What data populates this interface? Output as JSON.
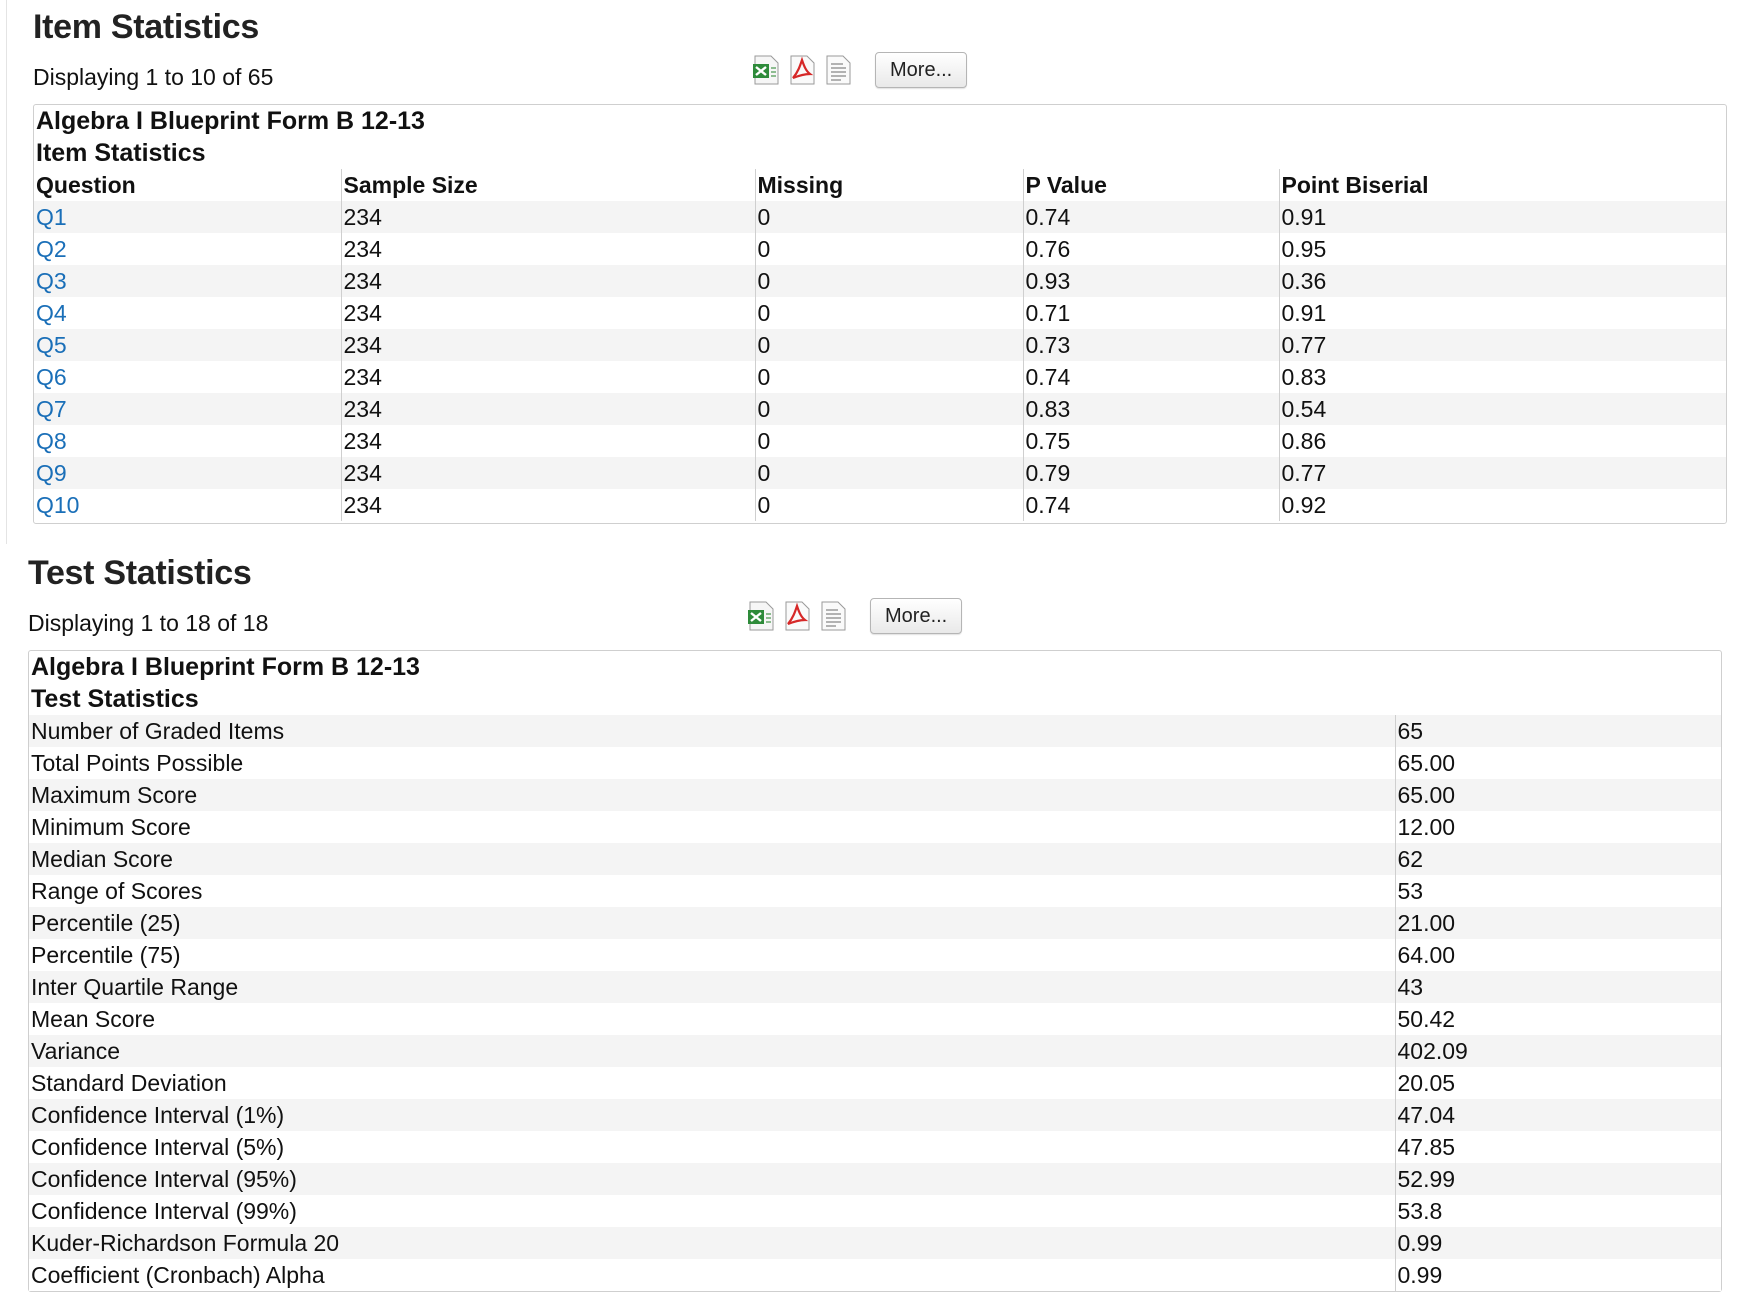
{
  "item_section": {
    "title": "Item Statistics",
    "display_count": "Displaying 1 to 10 of 65",
    "more_label": "More...",
    "report_title": "Algebra I Blueprint Form B 12-13",
    "report_subtitle": "Item Statistics",
    "columns": [
      "Question",
      "Sample Size",
      "Missing",
      "P Value",
      "Point Biserial"
    ],
    "rows": [
      [
        "Q1",
        "234",
        "0",
        "0.74",
        "0.91"
      ],
      [
        "Q2",
        "234",
        "0",
        "0.76",
        "0.95"
      ],
      [
        "Q3",
        "234",
        "0",
        "0.93",
        "0.36"
      ],
      [
        "Q4",
        "234",
        "0",
        "0.71",
        "0.91"
      ],
      [
        "Q5",
        "234",
        "0",
        "0.73",
        "0.77"
      ],
      [
        "Q6",
        "234",
        "0",
        "0.74",
        "0.83"
      ],
      [
        "Q7",
        "234",
        "0",
        "0.83",
        "0.54"
      ],
      [
        "Q8",
        "234",
        "0",
        "0.75",
        "0.86"
      ],
      [
        "Q9",
        "234",
        "0",
        "0.79",
        "0.77"
      ],
      [
        "Q10",
        "234",
        "0",
        "0.74",
        "0.92"
      ]
    ]
  },
  "test_section": {
    "title": "Test Statistics",
    "display_count": "Displaying 1 to 18 of 18",
    "more_label": "More...",
    "report_title": "Algebra I Blueprint Form B 12-13",
    "report_subtitle": "Test Statistics",
    "rows": [
      [
        "Number of Graded Items",
        "65"
      ],
      [
        "Total Points Possible",
        "65.00"
      ],
      [
        "Maximum Score",
        "65.00"
      ],
      [
        "Minimum Score",
        "12.00"
      ],
      [
        "Median Score",
        "62"
      ],
      [
        "Range of Scores",
        "53"
      ],
      [
        "Percentile (25)",
        "21.00"
      ],
      [
        "Percentile (75)",
        "64.00"
      ],
      [
        "Inter Quartile Range",
        "43"
      ],
      [
        "Mean Score",
        "50.42"
      ],
      [
        "Variance",
        "402.09"
      ],
      [
        "Standard Deviation",
        "20.05"
      ],
      [
        "Confidence Interval (1%)",
        "47.04"
      ],
      [
        "Confidence Interval (5%)",
        "47.85"
      ],
      [
        "Confidence Interval (95%)",
        "52.99"
      ],
      [
        "Confidence Interval (99%)",
        "53.8"
      ],
      [
        "Kuder-Richardson Formula 20",
        "0.99"
      ],
      [
        "Coefficient (Cronbach) Alpha",
        "0.99"
      ]
    ]
  },
  "icons": [
    "excel-export-icon",
    "pdf-export-icon",
    "text-export-icon"
  ],
  "colors": {
    "link": "#1a6fb8",
    "excel_green": "#2e8b3a",
    "pdf_red": "#d62828",
    "row_stripe": "#f4f4f4"
  }
}
